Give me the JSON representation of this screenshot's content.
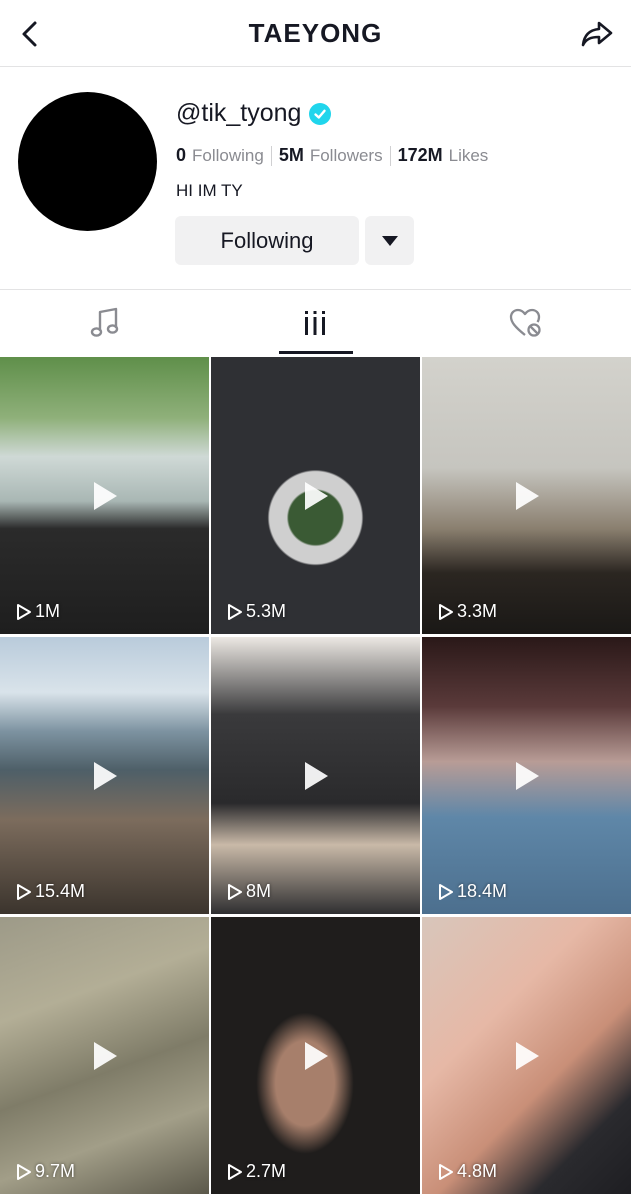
{
  "header": {
    "title": "TAEYONG",
    "back_icon": "chevron-left-icon",
    "share_icon": "share-arrow-icon"
  },
  "profile": {
    "username": "@tik_tyong",
    "verified": true,
    "stats": {
      "following_count": "0",
      "following_label": "Following",
      "followers_count": "5M",
      "followers_label": "Followers",
      "likes_count": "172M",
      "likes_label": "Likes"
    },
    "bio": "HI IM TY",
    "follow_button_label": "Following",
    "accent_color": "#20d5ec"
  },
  "tabs": [
    {
      "icon": "music-note-icon",
      "active": false
    },
    {
      "icon": "grid-icon",
      "active": true
    },
    {
      "icon": "liked-heart-icon",
      "active": false
    }
  ],
  "videos": [
    {
      "views": "1M"
    },
    {
      "views": "5.3M"
    },
    {
      "views": "3.3M"
    },
    {
      "views": "15.4M"
    },
    {
      "views": "8M"
    },
    {
      "views": "18.4M"
    },
    {
      "views": "9.7M"
    },
    {
      "views": "2.7M"
    },
    {
      "views": "4.8M"
    }
  ]
}
